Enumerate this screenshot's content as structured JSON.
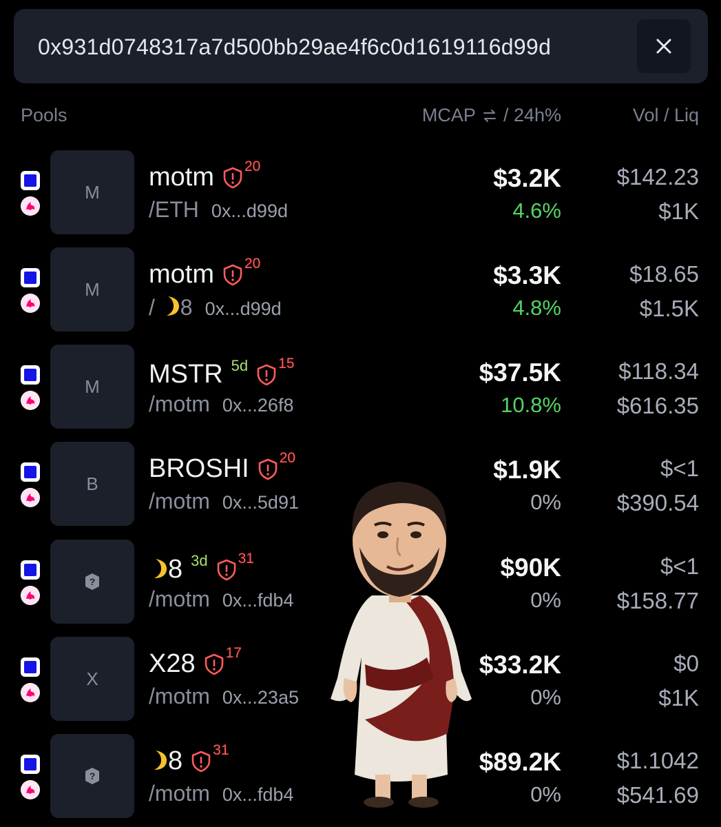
{
  "search": {
    "value": "0x931d0748317a7d500bb29ae4f6c0d1619116d99d",
    "clear_icon": "close-icon"
  },
  "header": {
    "pools": "Pools",
    "mcap": "MCAP",
    "mcap_sep": "/ 24h%",
    "vol_liq": "Vol / Liq"
  },
  "colors": {
    "positive": "#56d364",
    "neutral": "#a8adb9",
    "risk": "#ff5b5b",
    "age": "#a9e06a"
  },
  "pools": [
    {
      "thumb": "M",
      "name": "motm",
      "age": "",
      "risk": "20",
      "pair": "/ETH",
      "addr": "0x...d99d",
      "mcap": "$3.2K",
      "change": "4.6%",
      "change_color": "#56d364",
      "vol": "$142.23",
      "liq": "$1K"
    },
    {
      "thumb": "M",
      "name": "motm",
      "age": "",
      "risk": "20",
      "pair": "8",
      "addr": "0x...d99d",
      "mcap": "$3.3K",
      "change": "4.8%",
      "change_color": "#56d364",
      "vol": "$18.65",
      "liq": "$1.5K"
    },
    {
      "thumb": "M",
      "name": "MSTR",
      "age": "5d",
      "risk": "15",
      "pair": "/motm",
      "addr": "0x...26f8",
      "mcap": "$37.5K",
      "change": "10.8%",
      "change_color": "#56d364",
      "vol": "$118.34",
      "liq": "$616.35"
    },
    {
      "thumb": "B",
      "name": "BROSHI",
      "age": "",
      "risk": "20",
      "pair": "/motm",
      "addr": "0x...5d91",
      "mcap": "$1.9K",
      "change": "0%",
      "change_color": "#a8adb9",
      "vol": "$<1",
      "liq": "$390.54"
    },
    {
      "thumb": "",
      "name": "8",
      "age": "3d",
      "risk": "31",
      "pair": "/motm",
      "addr": "0x...fdb4",
      "mcap": "$90K",
      "change": "0%",
      "change_color": "#a8adb9",
      "vol": "$<1",
      "liq": "$158.77"
    },
    {
      "thumb": "X",
      "name": "X28",
      "age": "",
      "risk": "17",
      "pair": "/motm",
      "addr": "0x...23a5",
      "mcap": "$33.2K",
      "change": "0%",
      "change_color": "#a8adb9",
      "vol": "$0",
      "liq": "$1K"
    },
    {
      "thumb": "",
      "name": "8",
      "age": "",
      "risk": "31",
      "pair": "/motm",
      "addr": "0x...fdb4",
      "mcap": "$89.2K",
      "change": "0%",
      "change_color": "#a8adb9",
      "vol": "$1.1042",
      "liq": "$541.69"
    }
  ]
}
